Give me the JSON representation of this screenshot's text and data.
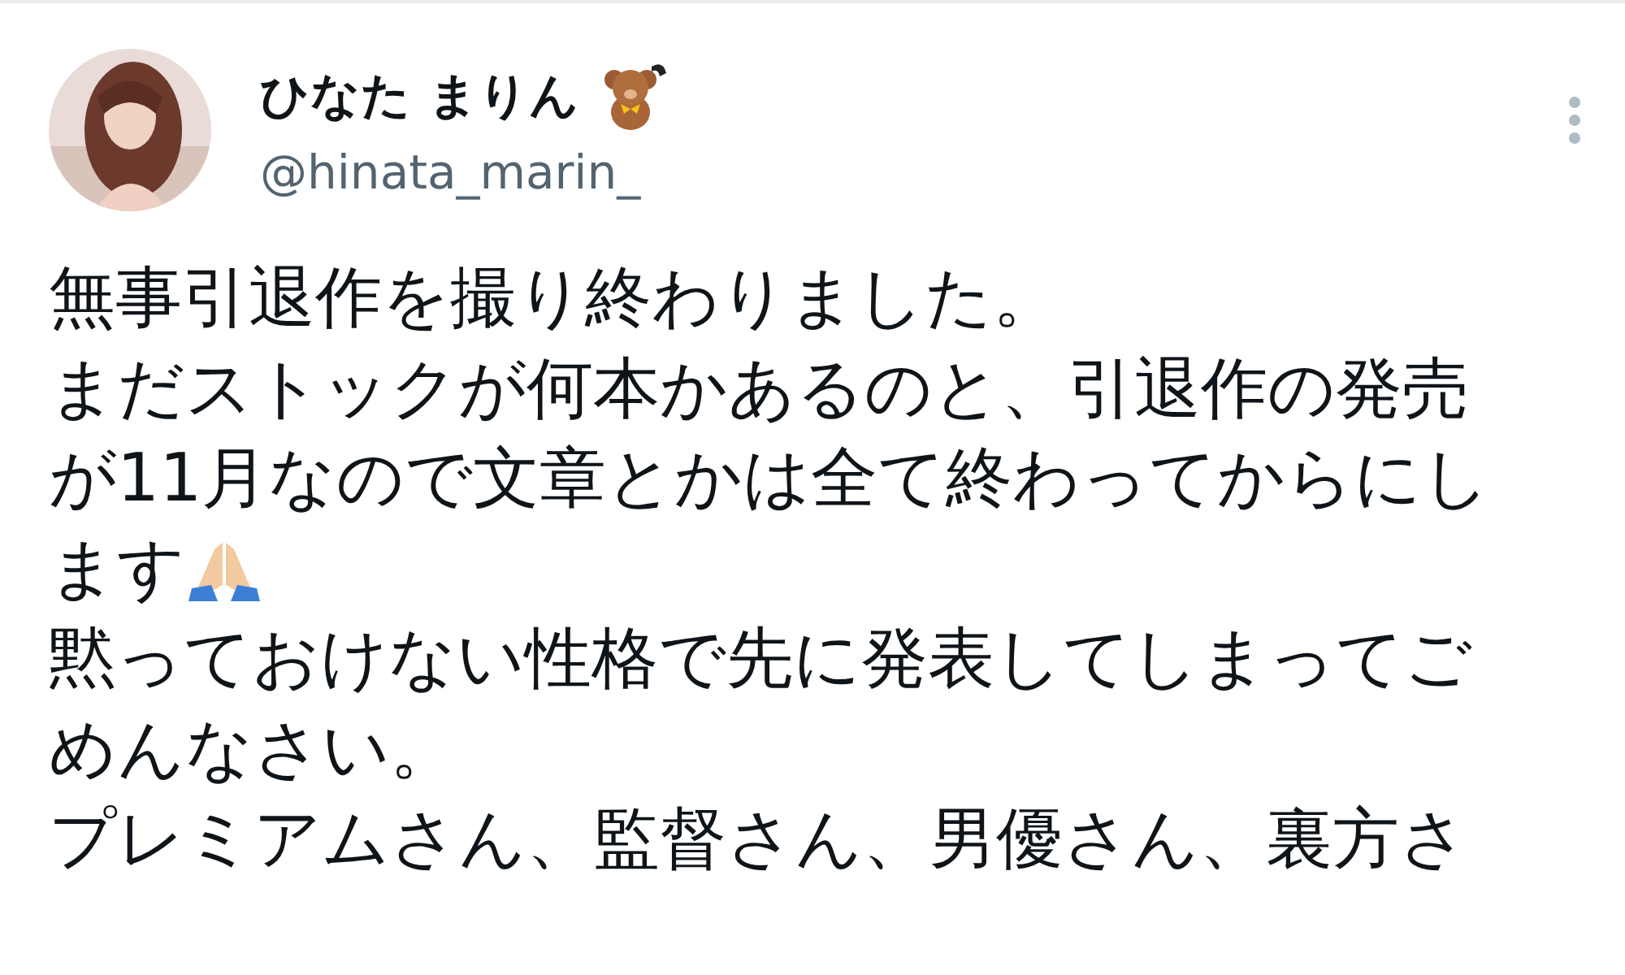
{
  "author": {
    "name": "ひなた まりん",
    "handle": "@hinata_marin_"
  },
  "body_lines": [
    {
      "text": "無事引退作を撮り終わりました。",
      "icon": false
    },
    {
      "text": "まだストックが何本かあるのと、引退作の発売",
      "icon": false
    },
    {
      "text": "が11月なので文章とかは全て終わってからにし",
      "icon": false
    },
    {
      "text": "ます",
      "icon": true
    },
    {
      "text": "黙っておけない性格で先に発表してしまってご",
      "icon": false
    },
    {
      "text": "めんなさい。",
      "icon": false
    },
    {
      "text": "プレミアムさん、監督さん、男優さん、裏方さ",
      "icon": false
    }
  ]
}
